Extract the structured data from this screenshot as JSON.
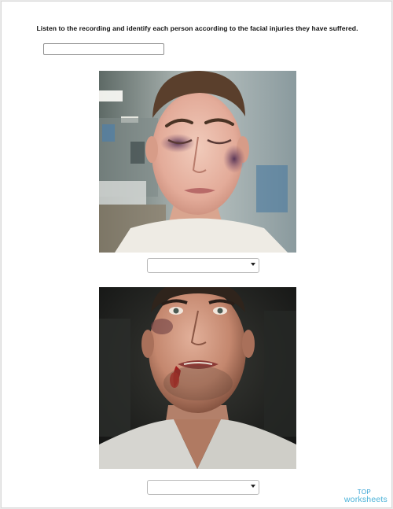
{
  "worksheet": {
    "instruction": "Listen to the recording and identify each person according to the facial injuries they have suffered.",
    "answer_input": {
      "value": "",
      "placeholder": ""
    },
    "items": [
      {
        "photo": "bruised-eye-young-man-photo",
        "dropdown": {
          "selected": ""
        }
      },
      {
        "photo": "bleeding-lip-young-man-photo",
        "dropdown": {
          "selected": ""
        }
      }
    ]
  },
  "logo": {
    "line1": "TOP",
    "line2": "worksheets",
    "color": "#3aa9d6"
  },
  "colors": {
    "caret": "#222222",
    "input_border": "#8f8f8f",
    "select_border": "#b9b9b9"
  }
}
